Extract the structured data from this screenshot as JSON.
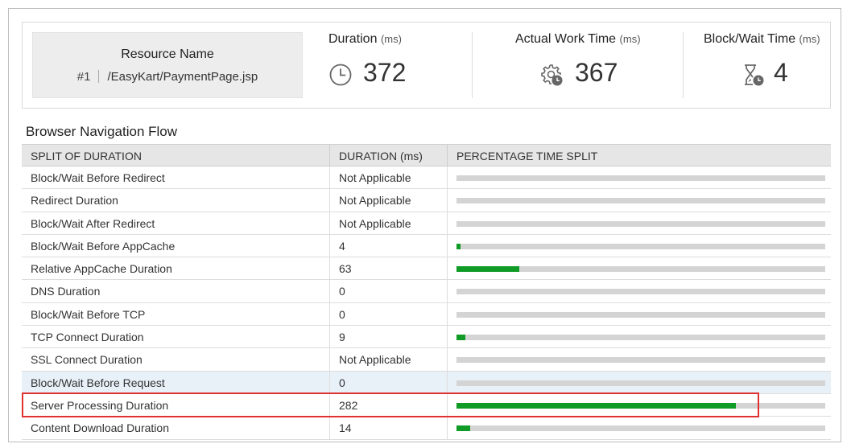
{
  "summary": {
    "resource": {
      "title": "Resource Name",
      "number": "#1",
      "path": "/EasyKart/PaymentPage.jsp"
    },
    "metrics": [
      {
        "label": "Duration",
        "unit": "(ms)",
        "value": "372",
        "icon": "clock-icon"
      },
      {
        "label": "Actual Work Time",
        "unit": "(ms)",
        "value": "367",
        "icon": "gear-clock-icon"
      },
      {
        "label": "Block/Wait Time",
        "unit": "(ms)",
        "value": "4",
        "icon": "hourglass-clock-icon"
      }
    ]
  },
  "flow": {
    "title": "Browser Navigation Flow",
    "columns": [
      "SPLIT OF DURATION",
      "DURATION (ms)",
      "PERCENTAGE TIME SPLIT"
    ],
    "total_ms": 372,
    "rows": [
      {
        "name": "Block/Wait Before Redirect",
        "duration": "Not Applicable",
        "value": 0
      },
      {
        "name": "Redirect Duration",
        "duration": "Not Applicable",
        "value": 0
      },
      {
        "name": "Block/Wait After Redirect",
        "duration": "Not Applicable",
        "value": 0
      },
      {
        "name": "Block/Wait Before AppCache",
        "duration": "4",
        "value": 4
      },
      {
        "name": "Relative AppCache Duration",
        "duration": "63",
        "value": 63
      },
      {
        "name": "DNS Duration",
        "duration": "0",
        "value": 0
      },
      {
        "name": "Block/Wait Before TCP",
        "duration": "0",
        "value": 0
      },
      {
        "name": "TCP Connect Duration",
        "duration": "9",
        "value": 9
      },
      {
        "name": "SSL Connect Duration",
        "duration": "Not Applicable",
        "value": 0
      },
      {
        "name": "Block/Wait Before Request",
        "duration": "0",
        "value": 0,
        "highlighted": true
      },
      {
        "name": "Server Processing Duration",
        "duration": "282",
        "value": 282,
        "outlined": true
      },
      {
        "name": "Content Download Duration",
        "duration": "14",
        "value": 14
      }
    ]
  },
  "colors": {
    "bar_fill": "#0f9b25",
    "bar_track": "#d4d4d4",
    "outline": "#e03030",
    "row_highlight": "#e8f0f8",
    "header_bg": "#e6e6e6"
  }
}
